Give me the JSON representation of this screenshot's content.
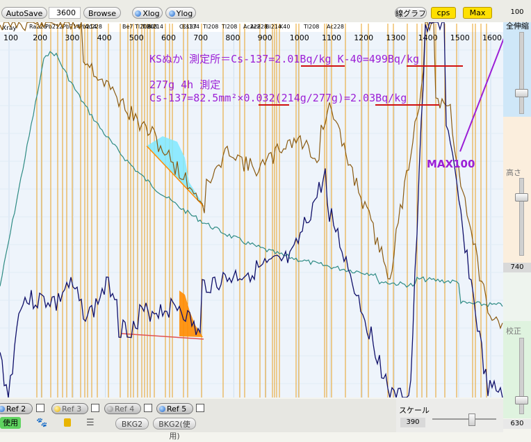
{
  "toolbar": {
    "autosave_label": "AutoSave",
    "time_value": "3600",
    "browse_label": "Browse",
    "xlog_label": "Xlog",
    "ylog_label": "Ylog",
    "graph_mode_label": "線グラフ",
    "cps_label": "cps",
    "max_label": "Max",
    "max_value": "100"
  },
  "axis": {
    "xray_label": "Xray",
    "ticks": [
      "100",
      "200",
      "300",
      "400",
      "500",
      "600",
      "700",
      "800",
      "900",
      "1000",
      "1100",
      "1200",
      "1300",
      "1400",
      "1500",
      "1600"
    ],
    "nuclides": [
      "Ra226",
      "Pb212",
      "Pb214",
      "Pb214",
      "Ac228",
      "Be7",
      "Tl208",
      "Tl208",
      "Bi214",
      "Cs137",
      "Cs134",
      "Tl208",
      "Tl208",
      "Ac228",
      "Ac228",
      "Bi214",
      "K40",
      "Tl208",
      "Ac228"
    ]
  },
  "annotations": {
    "line1": "KSぬか 測定所＝Cs-137=2.01Bq/kg K-40=499Bq/kg",
    "line2": "277g 4h 測定",
    "line3": "Cs-137=82.5mm²×0.032(214g/277g)=2.03Bq/kg",
    "max_note": "MAX100"
  },
  "right_panel": {
    "expand_label": "全伸縮",
    "height_label": "高さ",
    "height_value": "740",
    "calib_label": "校正",
    "calib_value": "630"
  },
  "bottom": {
    "refs": [
      {
        "label": "Ref 2"
      },
      {
        "label": "Ref 3"
      },
      {
        "label": "Ref 4"
      },
      {
        "label": "Ref 5"
      }
    ],
    "use_label": "使用",
    "bkg2_label": "BKG2",
    "bkg2_use_label": "BKG2(使用)",
    "scale_label": "スケール",
    "scale_value": "390"
  },
  "colors": {
    "plot_bg": "#eef4fb",
    "grid": "#cfe0f0",
    "marker": "#e8a020",
    "brown_series": "#8a5a10",
    "teal_series": "#2e8b84",
    "navy_series": "#10106a",
    "annotation": "#9b1fd6",
    "underline": "#d01010",
    "cs_fill": "#7fe8ff",
    "cs_fill2": "#ff8c00"
  }
}
